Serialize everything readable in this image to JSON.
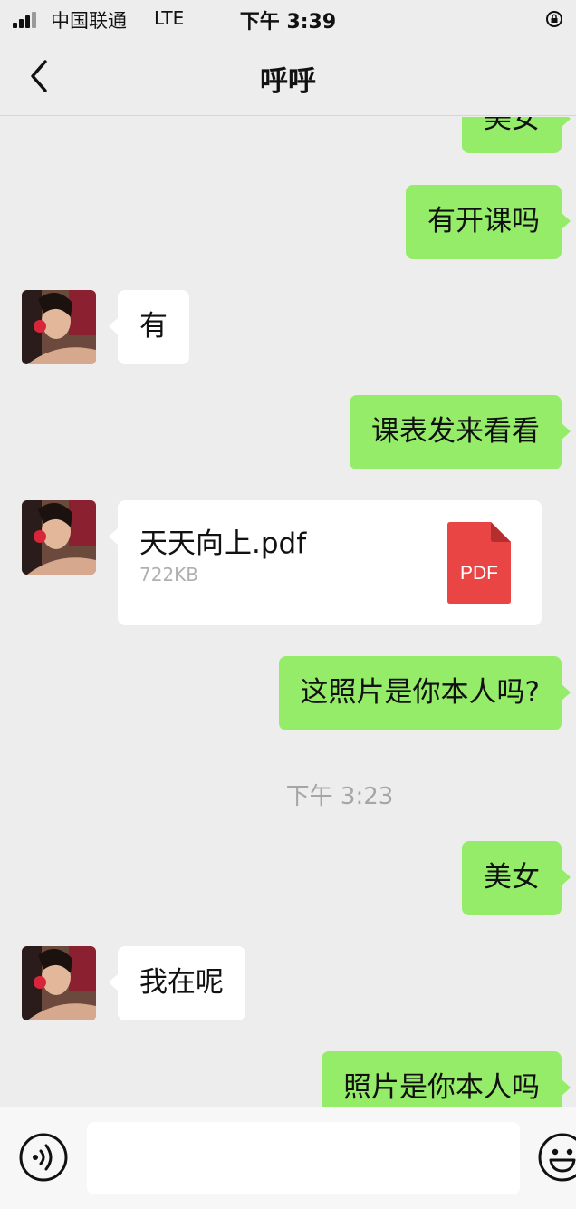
{
  "status_bar": {
    "carrier": "中国联通",
    "network": "LTE",
    "time": "下午 3:39"
  },
  "nav": {
    "title": "呼呼",
    "back_icon": "chevron-left-icon"
  },
  "messages": [
    {
      "id": "m0",
      "side": "out",
      "text": "美女"
    },
    {
      "id": "m1",
      "side": "out",
      "text": "有开课吗"
    },
    {
      "id": "m2",
      "side": "in",
      "text": "有"
    },
    {
      "id": "m3",
      "side": "out",
      "text": "课表发来看看"
    },
    {
      "id": "m4",
      "side": "in",
      "type": "file",
      "file_name": "天天向上.pdf",
      "file_size": "722KB",
      "file_icon": "PDF"
    },
    {
      "id": "m5",
      "side": "out",
      "text": "这照片是你本人吗?"
    },
    {
      "id": "m6",
      "type": "time",
      "text": "下午 3:23"
    },
    {
      "id": "m7",
      "side": "out",
      "text": "美女"
    },
    {
      "id": "m8",
      "side": "in",
      "text": "我在呢"
    },
    {
      "id": "m9",
      "side": "out",
      "text": "照片是你本人吗"
    }
  ],
  "input_bar": {
    "voice_icon": "voice-icon",
    "emoji_icon": "emoji-icon",
    "input_value": ""
  },
  "colors": {
    "background": "#ededed",
    "outgoing_bubble": "#95ec69",
    "incoming_bubble": "#ffffff",
    "pdf_red": "#e94545"
  }
}
